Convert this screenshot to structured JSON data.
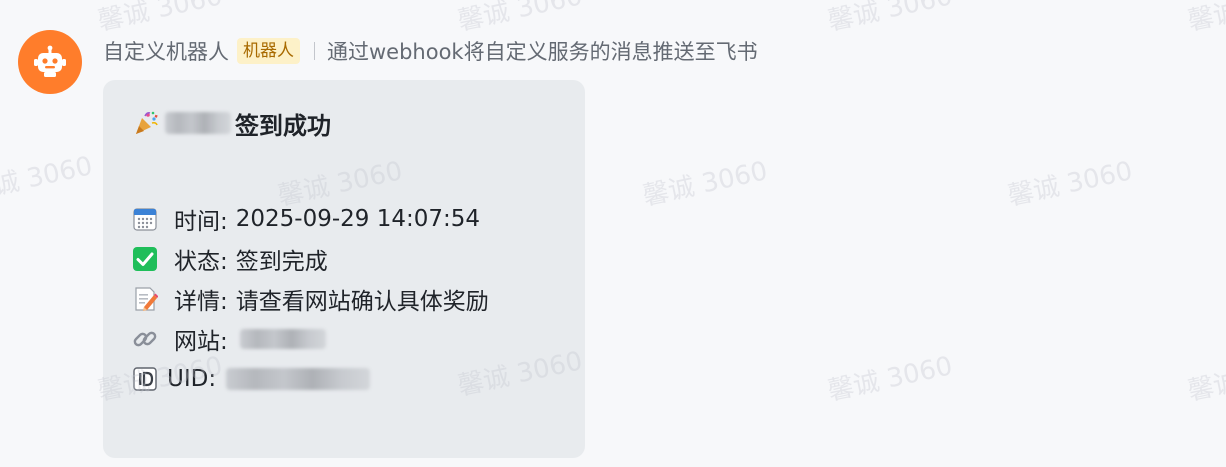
{
  "bot": {
    "name": "自定义机器人",
    "tag": "机器人",
    "description": "通过webhook将自定义服务的消息推送至飞书",
    "avatar_color": "#ff7d2b"
  },
  "card": {
    "title_icon": "party-popper-icon",
    "title_suffix": "签到成功",
    "rows": [
      {
        "icon": "calendar-icon",
        "label": "时间:",
        "value": "2025-09-29 14:07:54"
      },
      {
        "icon": "check-box-icon",
        "label": "状态:",
        "value": "签到完成"
      },
      {
        "icon": "memo-icon",
        "label": "详情:",
        "value": "请查看网站确认具体奖励"
      },
      {
        "icon": "link-icon",
        "label": "网站:",
        "value": ""
      },
      {
        "icon": "id-icon",
        "label": "UID:",
        "value": ""
      }
    ]
  },
  "watermark": {
    "text": "馨诚 3060"
  },
  "colors": {
    "page_bg": "#f7f8fa",
    "card_bg": "#e8ebee",
    "tag_bg": "#fdf1c8",
    "tag_text": "#a86a00",
    "check_green": "#1fbe5a"
  }
}
